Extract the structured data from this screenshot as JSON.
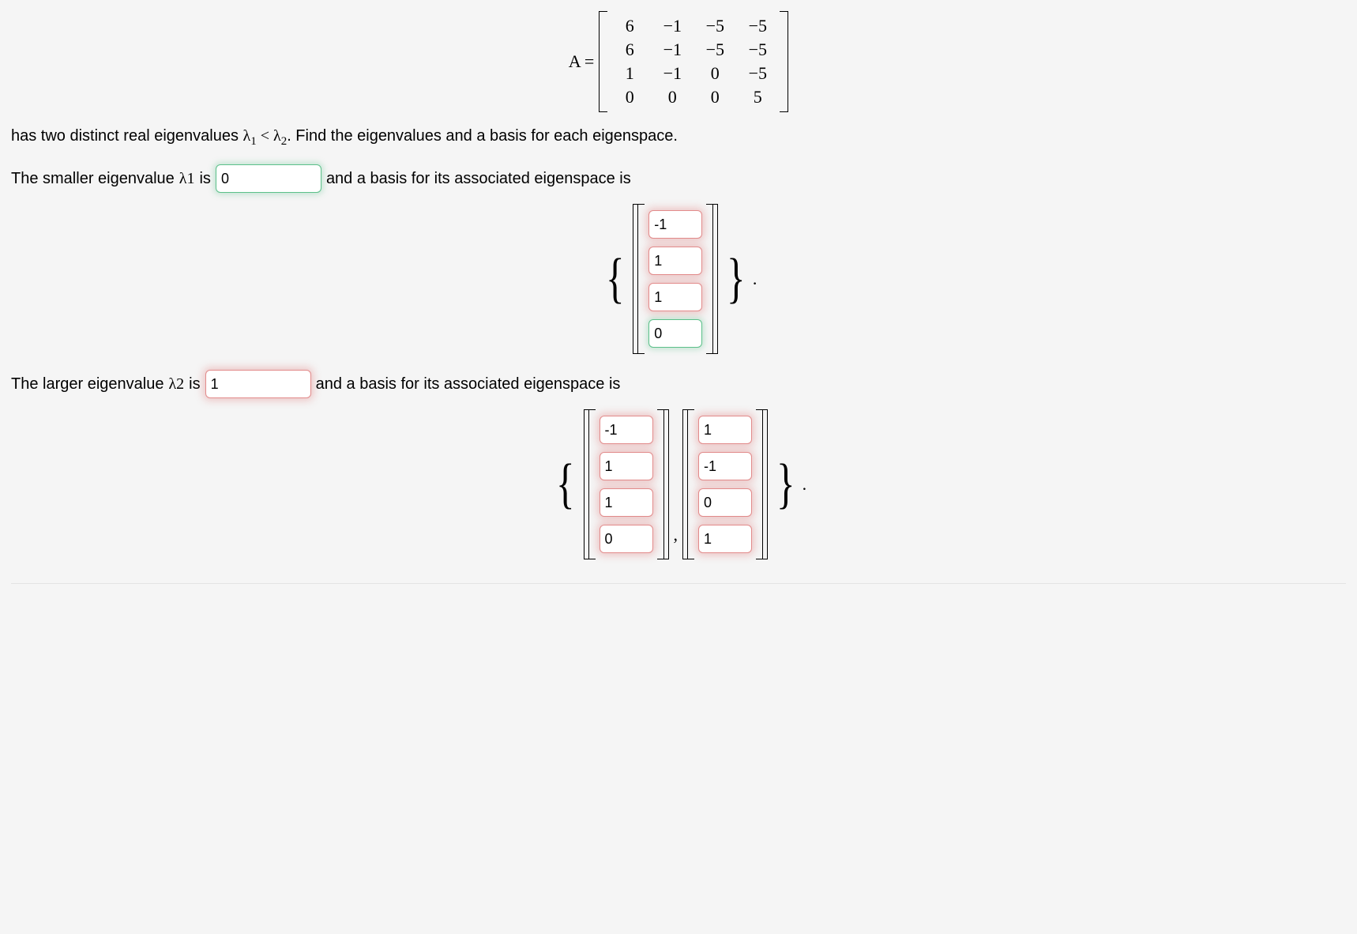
{
  "matrix_label": "A =",
  "matrix_rows": [
    [
      "6",
      "−1",
      "−5",
      "−5"
    ],
    [
      "6",
      "−1",
      "−5",
      "−5"
    ],
    [
      "1",
      "−1",
      "0",
      "−5"
    ],
    [
      "0",
      "0",
      "0",
      "5"
    ]
  ],
  "intro_text": {
    "pre": "has two distinct real eigenvalues ",
    "l1": "λ",
    "s1": "1",
    "lt": " < ",
    "l2": "λ",
    "s2": "2",
    "post": ". Find the eigenvalues and a basis for each eigenspace."
  },
  "q1": {
    "pre": "The smaller eigenvalue ",
    "sym": "λ",
    "sub": "1",
    "is": " is ",
    "value": "0",
    "status": "correct",
    "post": " and a basis for its associated eigenspace is"
  },
  "basis1": {
    "vectors": [
      {
        "entries": [
          "-1",
          "1",
          "1",
          "0"
        ],
        "statuses": [
          "incorrect",
          "incorrect",
          "incorrect",
          "correct"
        ]
      }
    ]
  },
  "q2": {
    "pre": "The larger eigenvalue ",
    "sym": "λ",
    "sub": "2",
    "is": " is ",
    "value": "1",
    "status": "incorrect",
    "post": " and a basis for its associated eigenspace is"
  },
  "basis2": {
    "vectors": [
      {
        "entries": [
          "-1",
          "1",
          "1",
          "0"
        ],
        "statuses": [
          "incorrect",
          "incorrect",
          "incorrect",
          "incorrect"
        ]
      },
      {
        "entries": [
          "1",
          "-1",
          "0",
          "1"
        ],
        "statuses": [
          "incorrect",
          "incorrect",
          "incorrect",
          "incorrect"
        ]
      }
    ]
  },
  "period": "."
}
